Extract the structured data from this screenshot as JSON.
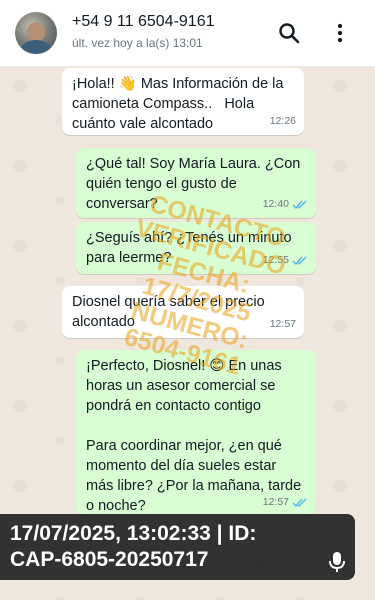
{
  "header": {
    "contact_name": "+54 9 11 6504-9161",
    "status": "últ. vez hoy a la(s) 13:01",
    "icons": {
      "search": "search-icon",
      "menu": "more-vert-icon"
    }
  },
  "messages": [
    {
      "direction": "in",
      "text": "¡Hola!! 👋 Mas Información de la camioneta Compass..   Hola cuánto vale alcontado",
      "time": "12:26",
      "read": false
    },
    {
      "direction": "out",
      "text": "¿Qué tal! Soy María Laura. ¿Con quién tengo el gusto de conversar?",
      "time": "12:40",
      "read": true
    },
    {
      "direction": "out",
      "text": "¿Seguís ahí? ¿Tenés un minuto para leerme?",
      "time": "12:55",
      "read": true
    },
    {
      "direction": "in",
      "text": "Diosnel quería saber el precio alcontado",
      "time": "12:57",
      "read": false
    },
    {
      "direction": "out",
      "text": "¡Perfecto, Diosnel! 😊 En unas horas un asesor comercial se pondrá en contacto contigo\n\nPara coordinar mejor, ¿en qué momento del día sueles estar más libre? ¿Por la mañana, tarde o noche?",
      "time": "12:57",
      "read": true
    }
  ],
  "watermark": {
    "lines": [
      "CONTACTO",
      "VERIFICADO",
      "FECHA:",
      "17/7/2025",
      "NUMERO:",
      "6504-9161"
    ]
  },
  "overlay": {
    "line1": "17/07/2025, 13:02:33 | ID:",
    "line2": "CAP-6805-20250717"
  },
  "colors": {
    "incoming_bubble": "#ffffff",
    "outgoing_bubble": "#d9fdd3",
    "chat_background": "#efe7de",
    "read_check": "#53bdeb",
    "watermark": "#e8a014"
  }
}
